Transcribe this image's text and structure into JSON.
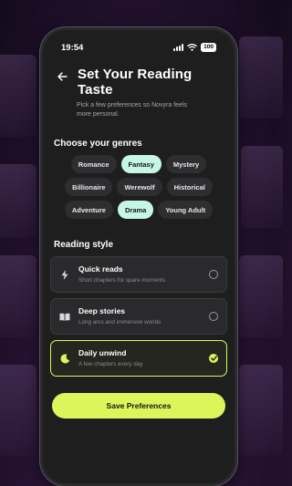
{
  "status": {
    "time": "19:54",
    "battery": "100"
  },
  "header": {
    "title_line1": "Set Your Reading",
    "title_line2": "Taste",
    "subtitle_line1": "Pick a few preferences so Novyra feels",
    "subtitle_line2": "more personal."
  },
  "genres": {
    "title": "Choose your genres",
    "rows": [
      [
        {
          "label": "Romance",
          "selected": false
        },
        {
          "label": "Fantasy",
          "selected": true
        },
        {
          "label": "Mystery",
          "selected": false
        }
      ],
      [
        {
          "label": "Billionaire",
          "selected": false
        },
        {
          "label": "Werewolf",
          "selected": false
        },
        {
          "label": "Historical",
          "selected": false
        }
      ],
      [
        {
          "label": "Adventure",
          "selected": false
        },
        {
          "label": "Drama",
          "selected": true
        },
        {
          "label": "Young Adult",
          "selected": false
        }
      ]
    ]
  },
  "reading_style": {
    "title": "Reading style",
    "options": [
      {
        "title": "Quick reads",
        "desc": "Short chapters for spare moments",
        "icon": "lightning-icon",
        "selected": false
      },
      {
        "title": "Deep stories",
        "desc": "Long arcs and immersive worlds",
        "icon": "book-icon",
        "selected": false
      },
      {
        "title": "Daily unwind",
        "desc": "A few chapters every day",
        "icon": "moon-icon",
        "selected": true
      }
    ]
  },
  "save_label": "Save Preferences",
  "colors": {
    "accent": "#dcf55a",
    "chip_selected": "#c6f6e4",
    "background": "#1e1e1f"
  }
}
